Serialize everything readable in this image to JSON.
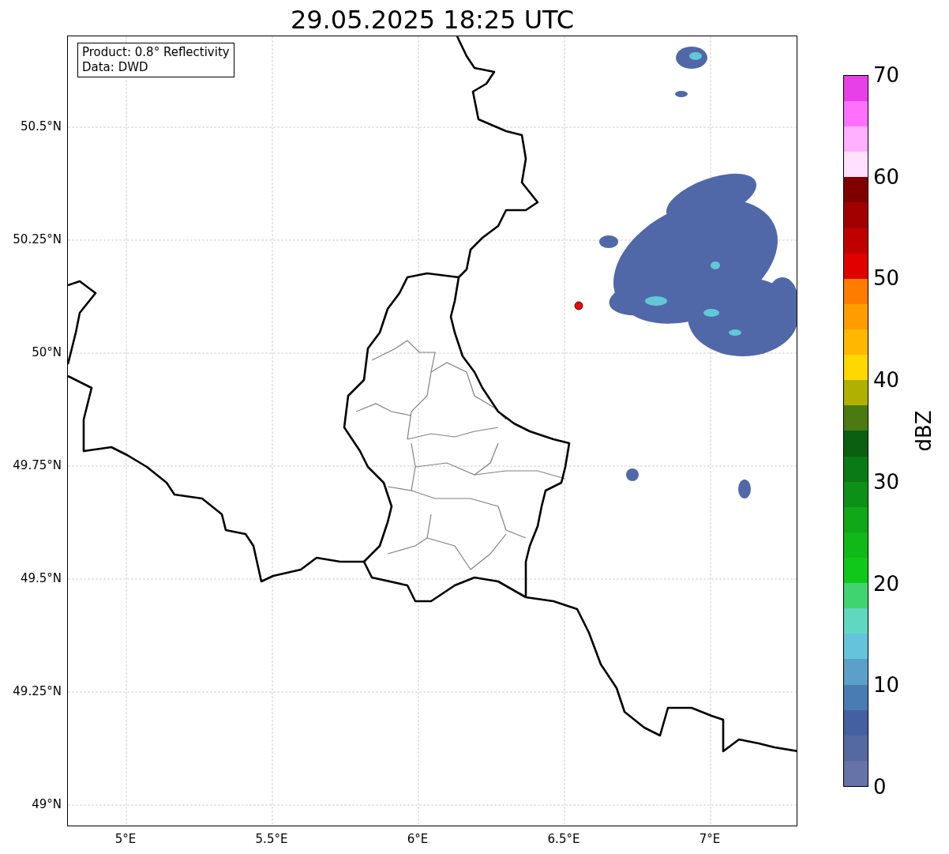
{
  "title": "29.05.2025 18:25 UTC",
  "info_box": {
    "lines": [
      "Product: 0.8° Reflectivity",
      "Data: DWD"
    ]
  },
  "map": {
    "lat_labels": [
      "50.5°N",
      "50.25°N",
      "50°N",
      "49.75°N",
      "49.5°N",
      "49.25°N",
      "49°N"
    ],
    "lon_labels": [
      "5°E",
      "5.5°E",
      "6°E",
      "6.5°E",
      "7°E"
    ]
  },
  "colorbar": {
    "label": "dBZ",
    "ticks": [
      "70",
      "60",
      "50",
      "40",
      "30",
      "20",
      "10",
      "0"
    ],
    "bins": [
      {
        "color": "#6573a8"
      },
      {
        "color": "#5568a0"
      },
      {
        "color": "#4560a0"
      },
      {
        "color": "#4a7cb4"
      },
      {
        "color": "#5ba0c8"
      },
      {
        "color": "#66c3dc"
      },
      {
        "color": "#60d8c0"
      },
      {
        "color": "#40d470"
      },
      {
        "color": "#10c81a"
      },
      {
        "color": "#10b818"
      },
      {
        "color": "#10a818"
      },
      {
        "color": "#0c9018"
      },
      {
        "color": "#0a7a14"
      },
      {
        "color": "#0a6010"
      },
      {
        "color": "#4a7a10"
      },
      {
        "color": "#b0b000"
      },
      {
        "color": "#ffd800"
      },
      {
        "color": "#ffb800"
      },
      {
        "color": "#ff9c00"
      },
      {
        "color": "#ff7c00"
      },
      {
        "color": "#e00000"
      },
      {
        "color": "#c00000"
      },
      {
        "color": "#a00000"
      },
      {
        "color": "#800000"
      },
      {
        "color": "#ffe0ff"
      },
      {
        "color": "#ffb0ff"
      },
      {
        "color": "#ff70ff"
      },
      {
        "color": "#e840e8"
      }
    ]
  }
}
